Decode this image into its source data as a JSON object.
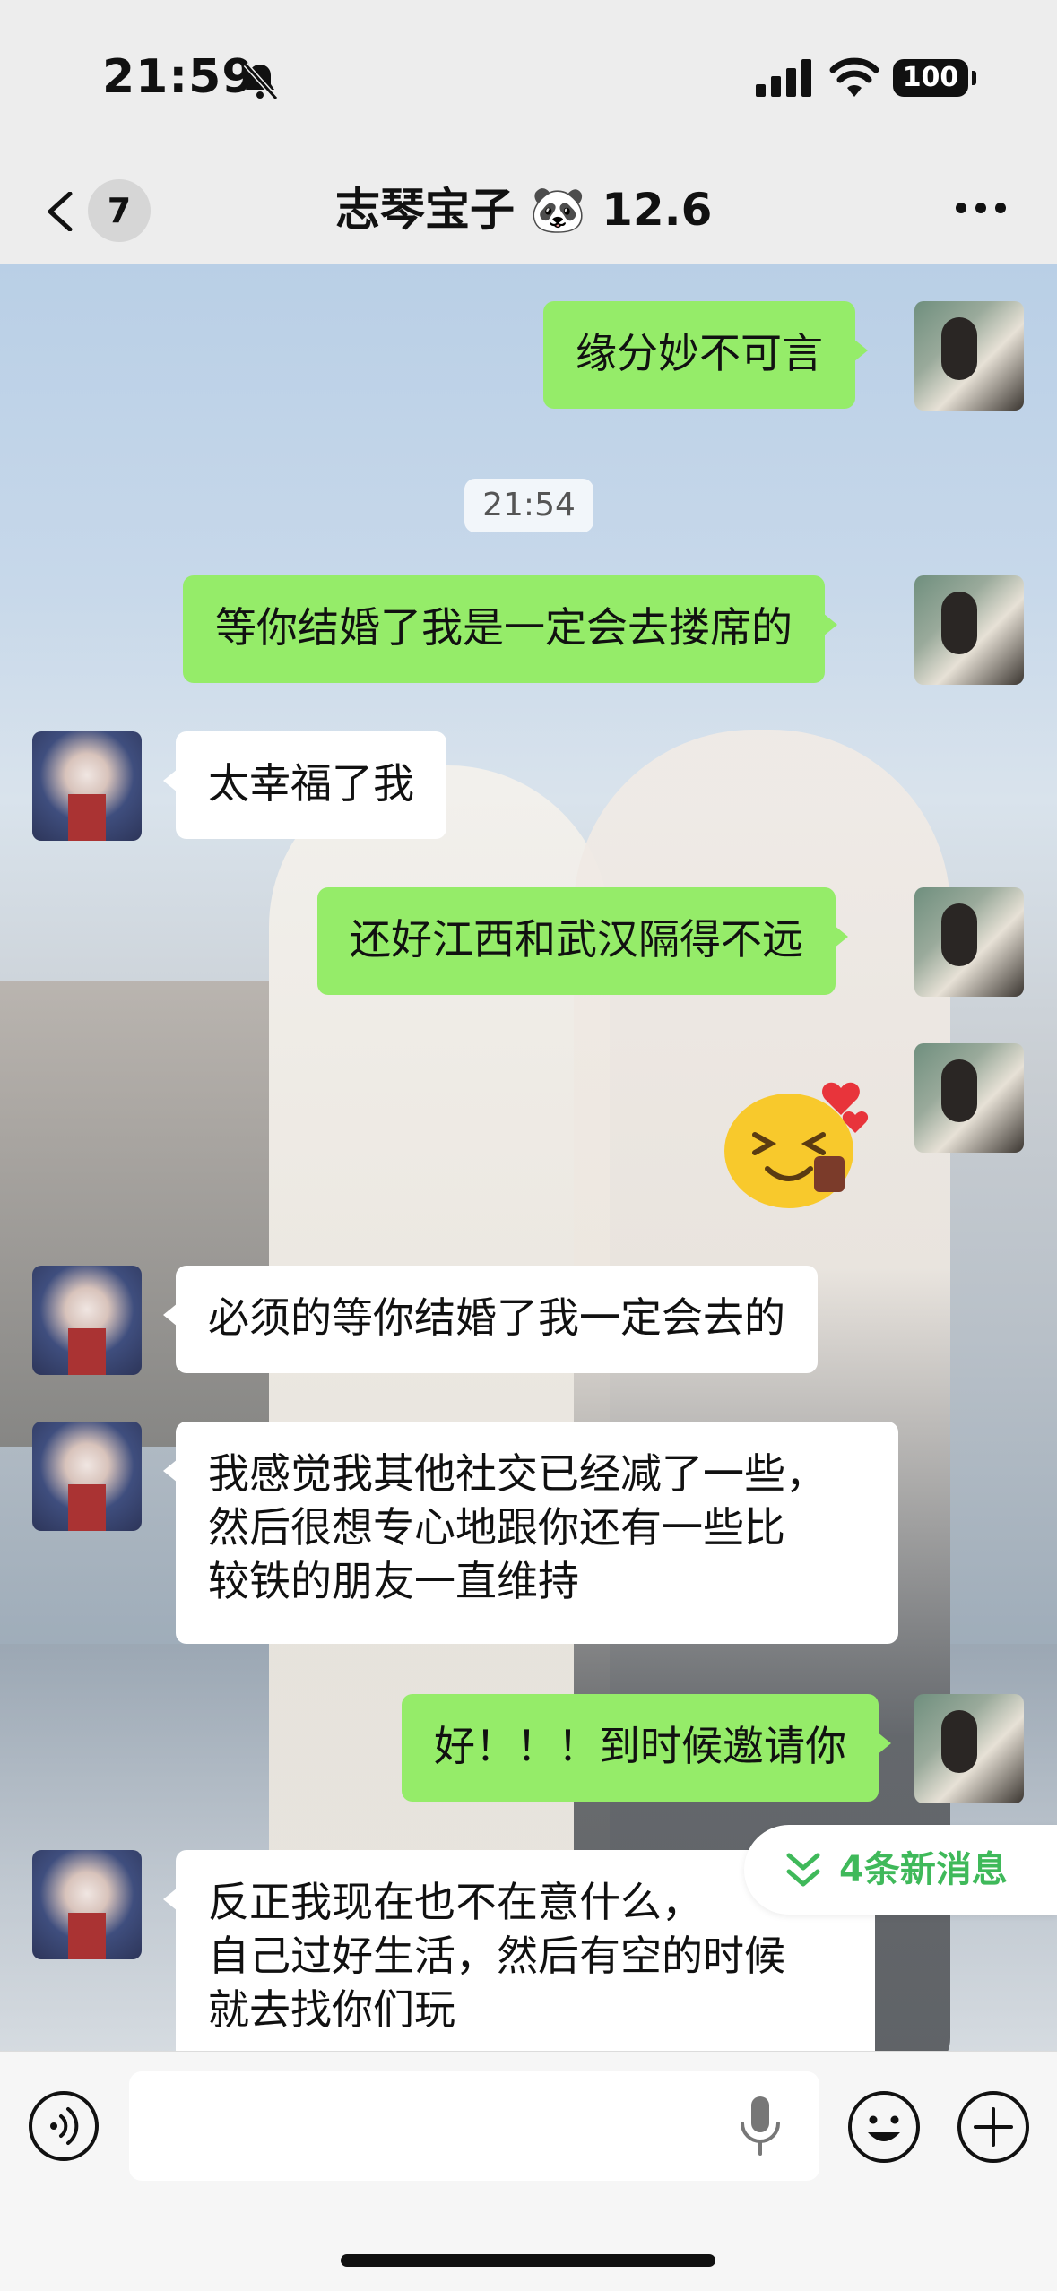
{
  "status_bar": {
    "time": "21:59",
    "battery": "100",
    "icons": [
      "bell-slash-icon",
      "cellular-signal-icon",
      "wifi-icon",
      "battery-icon"
    ]
  },
  "nav": {
    "unread_count": "7",
    "title": "志琴宝子 🐼 12.6",
    "icons": [
      "chevron-left-icon",
      "more-dots-icon"
    ]
  },
  "chat": {
    "timestamp": "21:54",
    "messages": [
      {
        "from": "self",
        "text": "缘分妙不可言"
      },
      {
        "from": "self",
        "text": "等你结婚了我是一定会去搂席的"
      },
      {
        "from": "friend",
        "text": "太幸福了我"
      },
      {
        "from": "self",
        "text": "还好江西和武汉隔得不远"
      },
      {
        "from": "self",
        "type": "sticker",
        "icon": "grinning-hug-sticker"
      },
      {
        "from": "friend",
        "text": "必须的等你结婚了我一定会去的"
      },
      {
        "from": "friend",
        "text": "我感觉我其他社交已经减了一些，\n然后很想专心地跟你还有一些比\n较铁的朋友一直维持"
      },
      {
        "from": "self",
        "text": "好！！！到时候邀请你"
      },
      {
        "from": "friend",
        "text": "反正我现在也不在意什么，\n自己过好生活，然后有空的时候\n就去找你们玩"
      }
    ],
    "new_messages_label": "4条新消息"
  },
  "input_bar": {
    "placeholder": "",
    "icons": [
      "voice-icon",
      "microphone-icon",
      "emoji-icon",
      "plus-icon"
    ]
  },
  "colors": {
    "outgoing_bubble": "#95ec69",
    "incoming_bubble": "#ffffff",
    "accent_green": "#3fb95a",
    "bar_background": "#ededed"
  }
}
